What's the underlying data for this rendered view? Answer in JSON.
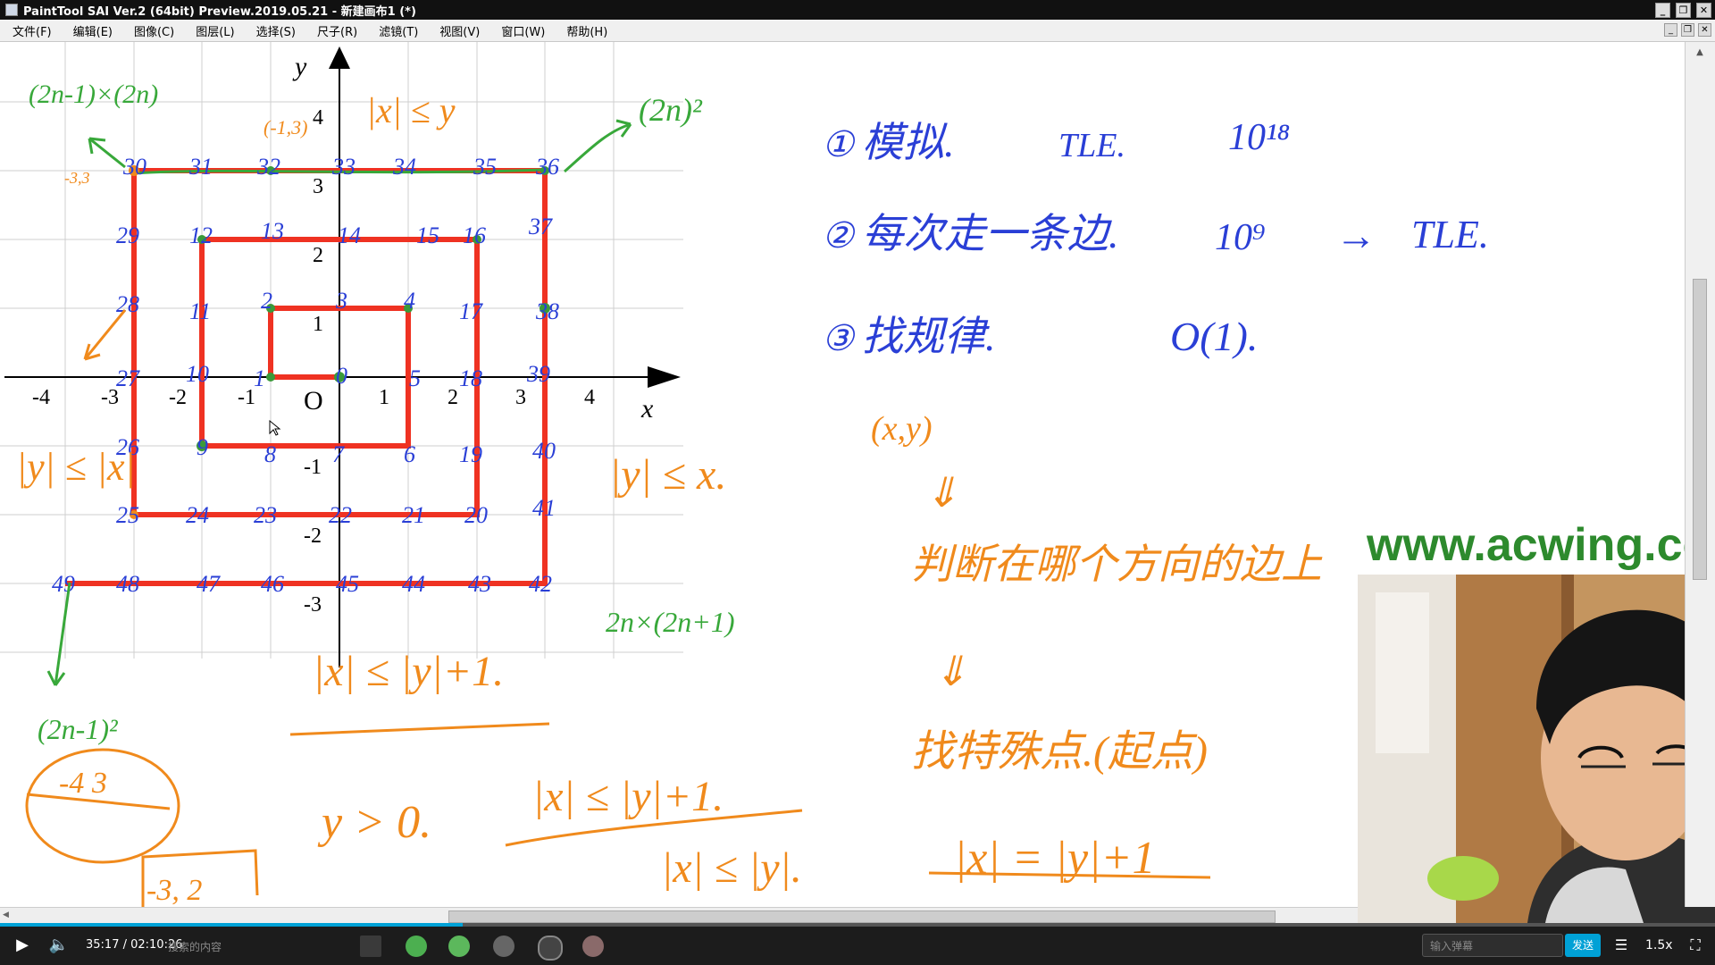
{
  "window": {
    "title": "PaintTool SAI Ver.2 (64bit) Preview.2019.05.21 - 新建画布1 (*)",
    "buttons": [
      "_",
      "❐",
      "✕"
    ]
  },
  "menu": {
    "items": [
      "文件(F)",
      "编辑(E)",
      "图像(C)",
      "图层(L)",
      "选择(S)",
      "尺子(R)",
      "滤镜(T)",
      "视图(V)",
      "窗口(W)",
      "帮助(H)"
    ]
  },
  "graph": {
    "y_axis_label": "y",
    "x_axis_label": "x",
    "origin_label": "O",
    "x_ticks": [
      "-4",
      "-3",
      "-2",
      "-1",
      "1",
      "2",
      "3",
      "4"
    ],
    "y_ticks": [
      "4",
      "3",
      "2",
      "1",
      "-1",
      "-2",
      "-3"
    ]
  },
  "annotations": {
    "corner_formula_top_left": "(2n-1)×(2n)",
    "corner_formula_top_right": "(2n)²",
    "corner_formula_bottom_left": "(2n-1)²",
    "corner_formula_right": "2n×(2n+1)",
    "point_label": "(-1,3)",
    "point_label_2": "-3,3",
    "cond_top": "|x| ≤ y",
    "cond_left": "|y| ≤ |x|",
    "cond_right": "|y| ≤ x.",
    "cond_bottom": "|x| ≤ |y|+1.",
    "circle_text": "-4 3",
    "box_text": "-3, 2",
    "y_cond": "y > 0.",
    "crossed_cond": "|x| ≤ |y|+1.",
    "cond_abs": "|x| ≤ |y|.",
    "eq_final": "|x| = |y|+1",
    "numbers": {
      "r1": [
        "30",
        "31",
        "32",
        "33",
        "34",
        "35",
        "36"
      ],
      "r2": [
        "29",
        "12",
        "13",
        "14",
        "15",
        "16",
        "37"
      ],
      "r3": [
        "28",
        "11",
        "2",
        "3",
        "4",
        "17",
        "38"
      ],
      "r4": [
        "27",
        "10",
        "1",
        "0",
        "5",
        "18",
        "39"
      ],
      "r5": [
        "26",
        "9",
        "8",
        "7",
        "6",
        "19",
        "40"
      ],
      "r6": [
        "25",
        "24",
        "23",
        "22",
        "21",
        "20",
        "41"
      ],
      "r7": [
        "49",
        "48",
        "47",
        "46",
        "45",
        "44",
        "43",
        "42"
      ]
    }
  },
  "notes": {
    "line1_num": "①",
    "line1": "模拟.",
    "line1_tle": "TLE.",
    "line1_big": "10¹⁸",
    "line2_num": "②",
    "line2": "每次走一条边.",
    "line2_big": "10⁹",
    "line2_arrow": "→",
    "line2_tle": "TLE.",
    "line3_num": "③",
    "line3": "找规律.",
    "line3_o": "O(1).",
    "xy": "(x,y)",
    "down1": "⇓",
    "judge": "判断在哪个方向的边上",
    "down2": "⇓",
    "special": "找特殊点.(起点)"
  },
  "watermark": "www.acwing.com",
  "player": {
    "time": "35:17 / 02:10:26",
    "search_hint": "搜索的内容",
    "danmaku_placeholder": "输入弹幕",
    "send_label": "发送",
    "speed": "1.5x",
    "progress": 0.27
  }
}
